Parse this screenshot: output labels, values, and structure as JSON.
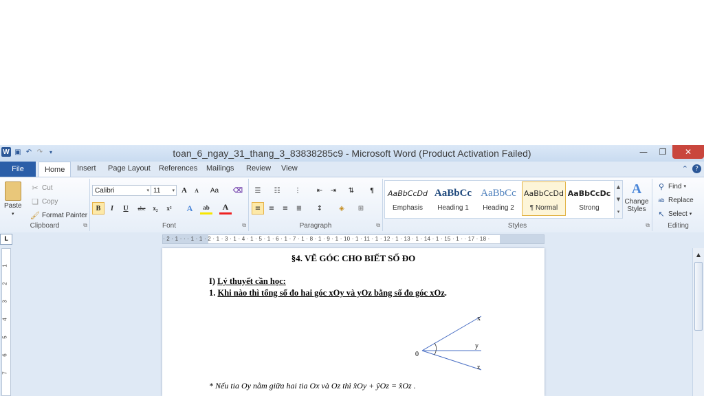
{
  "window": {
    "title": "toan_6_ngay_31_thang_3_83838285c9 - Microsoft Word (Product Activation Failed)"
  },
  "tabs": [
    "File",
    "Home",
    "Insert",
    "Page Layout",
    "References",
    "Mailings",
    "Review",
    "View"
  ],
  "clipboard": {
    "paste": "Paste",
    "cut": "Cut",
    "copy": "Copy",
    "format_painter": "Format Painter",
    "label": "Clipboard"
  },
  "font": {
    "name": "Calibri",
    "size": "11",
    "label": "Font",
    "bold": "B",
    "italic": "I",
    "underline": "U",
    "strike": "abc",
    "sub": "x₂",
    "sup": "x²",
    "grow": "A",
    "shrink": "A",
    "case": "Aa"
  },
  "paragraph": {
    "label": "Paragraph"
  },
  "styles": {
    "label": "Styles",
    "items": [
      {
        "preview": "AaBbCcDd",
        "name": "Emphasis"
      },
      {
        "preview": "AaBbCc",
        "name": "Heading 1"
      },
      {
        "preview": "AaBbCc",
        "name": "Heading 2"
      },
      {
        "preview": "AaBbCcDd",
        "name": "¶ Normal"
      },
      {
        "preview": "AaBbCcDc",
        "name": "Strong"
      }
    ],
    "change": "Change Styles"
  },
  "editing": {
    "find": "Find",
    "replace": "Replace",
    "select": "Select",
    "label": "Editing"
  },
  "ruler": {
    "h": "· 2 · 1 · ·  · 1 · 1 · 2 · 1 · 3 · 1 · 4 · 1 · 5 · 1 · 6 · 1 · 7 · 1 · 8 · 1 · 9 · 1 · 10 · 1 · 11 · 1 · 12 · 1 · 13 · 1 · 14 · 1 · 15 · 1 ·  · 17 · 18 ·",
    "v": [
      "1",
      "2",
      "3",
      "4",
      "5",
      "6",
      "7"
    ]
  },
  "document": {
    "title": "§4. VẼ GÓC CHO BIẾT SỐ ĐO",
    "section_prefix": "I)",
    "section_text": "Lý thuyết cần học:",
    "item_prefix": "1.",
    "item_text": "Khi nào thì tổng số đo hai góc xOy và yOz bằng số đo góc xOz",
    "item_suffix": ".",
    "diagram": {
      "x": "x",
      "y": "y",
      "z": "z",
      "o": "0"
    },
    "note": "* Nếu tia Oy nằm giữa hai tia Ox và Oz thì x̂Oy + ŷOz = x̂Oz ."
  }
}
